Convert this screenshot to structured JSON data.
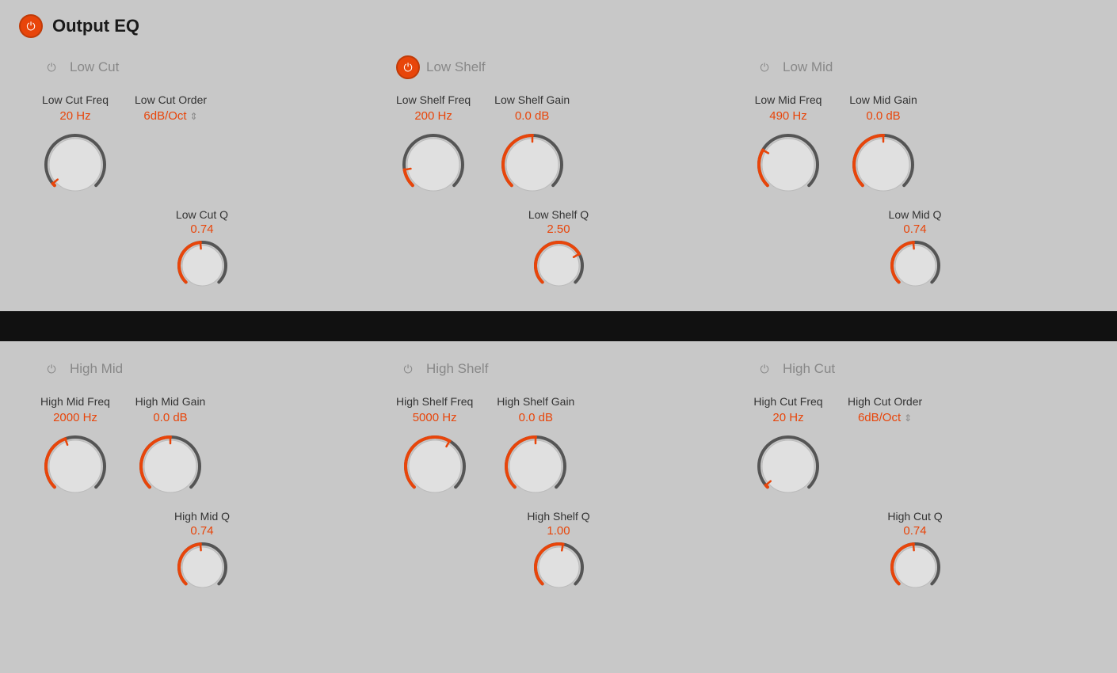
{
  "header": {
    "title": "Output EQ",
    "power_active": true
  },
  "top_bands": [
    {
      "id": "low-cut",
      "name": "Low Cut",
      "active": false,
      "controls": [
        {
          "id": "low-cut-freq",
          "label": "Low Cut Freq",
          "value": "20 Hz",
          "type": "knob",
          "knob_angle": -130
        },
        {
          "id": "low-cut-order",
          "label": "Low Cut Order",
          "value": "6dB/Oct",
          "type": "dropdown",
          "has_arrow": true
        }
      ],
      "q_label": "Low Cut Q",
      "q_value": "0.74",
      "q_knob_angle": -5
    },
    {
      "id": "low-shelf",
      "name": "Low Shelf",
      "active": true,
      "controls": [
        {
          "id": "low-shelf-freq",
          "label": "Low Shelf Freq",
          "value": "200 Hz",
          "type": "knob",
          "knob_angle": -100
        },
        {
          "id": "low-shelf-gain",
          "label": "Low Shelf Gain",
          "value": "0.0 dB",
          "type": "knob",
          "knob_angle": 0
        }
      ],
      "q_label": "Low Shelf Q",
      "q_value": "2.50",
      "q_knob_angle": 60
    },
    {
      "id": "low-mid",
      "name": "Low Mid",
      "active": false,
      "controls": [
        {
          "id": "low-mid-freq",
          "label": "Low Mid Freq",
          "value": "490 Hz",
          "type": "knob",
          "knob_angle": -60
        },
        {
          "id": "low-mid-gain",
          "label": "Low Mid Gain",
          "value": "0.0 dB",
          "type": "knob",
          "knob_angle": 0
        }
      ],
      "q_label": "Low Mid Q",
      "q_value": "0.74",
      "q_knob_angle": -5
    }
  ],
  "bottom_bands": [
    {
      "id": "high-mid",
      "name": "High Mid",
      "active": false,
      "controls": [
        {
          "id": "high-mid-freq",
          "label": "High Mid Freq",
          "value": "2000 Hz",
          "type": "knob",
          "knob_angle": -20
        },
        {
          "id": "high-mid-gain",
          "label": "High Mid Gain",
          "value": "0.0 dB",
          "type": "knob",
          "knob_angle": 0
        }
      ],
      "q_label": "High Mid Q",
      "q_value": "0.74",
      "q_knob_angle": -5
    },
    {
      "id": "high-shelf",
      "name": "High Shelf",
      "active": false,
      "controls": [
        {
          "id": "high-shelf-freq",
          "label": "High Shelf Freq",
          "value": "5000 Hz",
          "type": "knob",
          "knob_angle": 30
        },
        {
          "id": "high-shelf-gain",
          "label": "High Shelf Gain",
          "value": "0.0 dB",
          "type": "knob",
          "knob_angle": 0
        }
      ],
      "q_label": "High Shelf Q",
      "q_value": "1.00",
      "q_knob_angle": 10
    },
    {
      "id": "high-cut",
      "name": "High Cut",
      "active": false,
      "controls": [
        {
          "id": "high-cut-freq",
          "label": "High Cut Freq",
          "value": "20 Hz",
          "type": "knob",
          "knob_angle": -130
        },
        {
          "id": "high-cut-order",
          "label": "High Cut Order",
          "value": "6dB/Oct",
          "type": "dropdown",
          "has_arrow": true
        }
      ],
      "q_label": "High Cut Q",
      "q_value": "0.74",
      "q_knob_angle": -5
    }
  ]
}
